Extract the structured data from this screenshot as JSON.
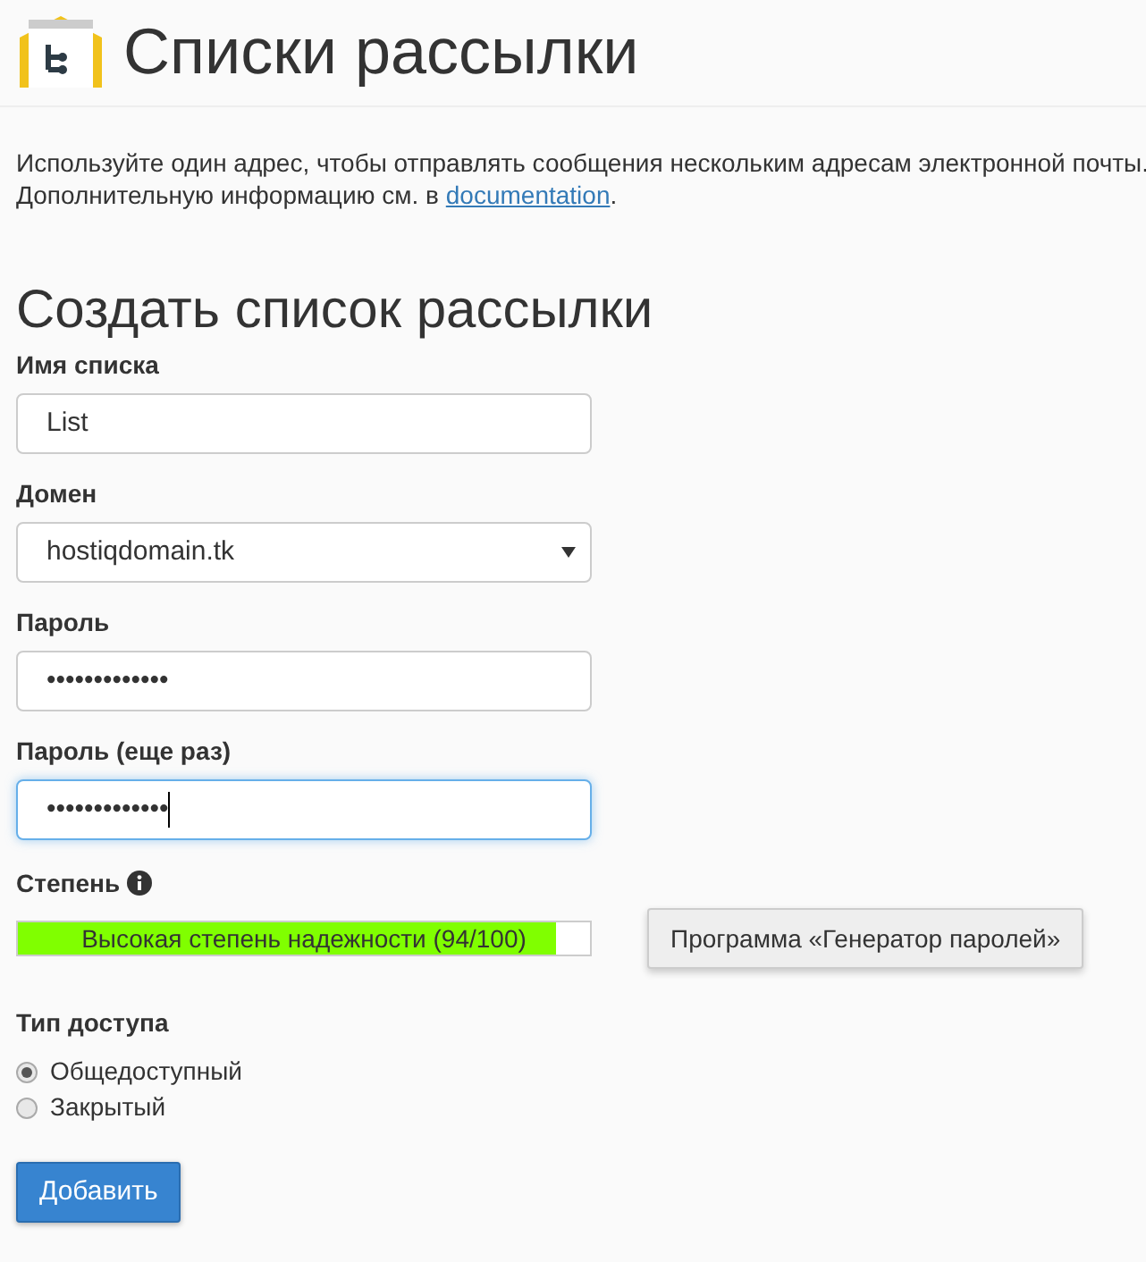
{
  "title": "Списки рассылки",
  "description": {
    "text": "Используйте один адрес, чтобы отправлять сообщения нескольким адресам электронной почты. Дополнительную информацию см. в",
    "link": "documentation",
    "after": "."
  },
  "form": {
    "heading": "Создать список рассылки",
    "fields": [
      {
        "kind": "text",
        "label": "Имя списка",
        "value": "List",
        "focused": false
      },
      {
        "kind": "select",
        "label": "Домен",
        "value": "hostiqdomain.tk",
        "focused": false
      },
      {
        "kind": "password",
        "label": "Пароль",
        "value": "•••••••••••••",
        "focused": false
      },
      {
        "kind": "password",
        "label": "Пароль (еще раз)",
        "value": "•••••••••••••",
        "focused": true
      }
    ],
    "strength": {
      "label": "Степень",
      "text": "Высокая степень надежности (94/100)",
      "level": 0.94
    },
    "generator_button": "Программа «Генератор паролей»",
    "access": {
      "label": "Тип доступа",
      "options": [
        {
          "label": "Общедоступный",
          "selected": true
        },
        {
          "label": "Закрытый",
          "selected": false
        }
      ]
    },
    "submit": "Добавить"
  }
}
